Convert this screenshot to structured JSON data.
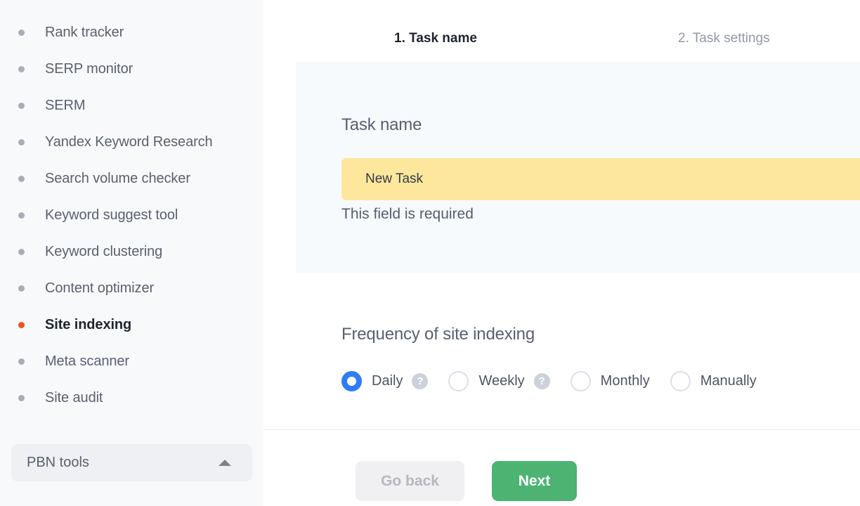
{
  "sidebar": {
    "items": [
      {
        "label": "Rank tracker",
        "active": false
      },
      {
        "label": "SERP monitor",
        "active": false
      },
      {
        "label": "SERM",
        "active": false
      },
      {
        "label": "Yandex Keyword Research",
        "active": false
      },
      {
        "label": "Search volume checker",
        "active": false
      },
      {
        "label": "Keyword suggest tool",
        "active": false
      },
      {
        "label": "Keyword clustering",
        "active": false
      },
      {
        "label": "Content optimizer",
        "active": false
      },
      {
        "label": "Site indexing",
        "active": true
      },
      {
        "label": "Meta scanner",
        "active": false
      },
      {
        "label": "Site audit",
        "active": false
      }
    ],
    "group": {
      "label": "PBN tools",
      "caret_icon": "chevron-up-icon"
    },
    "active_bullet_color": "#f4511e",
    "bullet_color": "#a8adb8"
  },
  "steps": [
    {
      "label": "1. Task name",
      "active": true
    },
    {
      "label": "2. Task settings",
      "active": false
    }
  ],
  "task_panel": {
    "title": "Task name",
    "input_value": "New Task",
    "input_placeholder": "New Task",
    "error_text": "This field is required",
    "input_highlight_color": "#fde79c",
    "panel_background": "#f6fafd"
  },
  "frequency": {
    "title": "Frequency of site indexing",
    "options": [
      {
        "label": "Daily",
        "selected": true,
        "has_help": true,
        "help_glyph": "?"
      },
      {
        "label": "Weekly",
        "selected": false,
        "has_help": true,
        "help_glyph": "?"
      },
      {
        "label": "Monthly",
        "selected": false,
        "has_help": false,
        "help_glyph": ""
      },
      {
        "label": "Manually",
        "selected": false,
        "has_help": false,
        "help_glyph": ""
      }
    ],
    "selected_color": "#2f7df6"
  },
  "footer": {
    "go_back_label": "Go back",
    "next_label": "Next",
    "next_color": "#4cb373",
    "go_back_color": "#f0f0f2"
  }
}
